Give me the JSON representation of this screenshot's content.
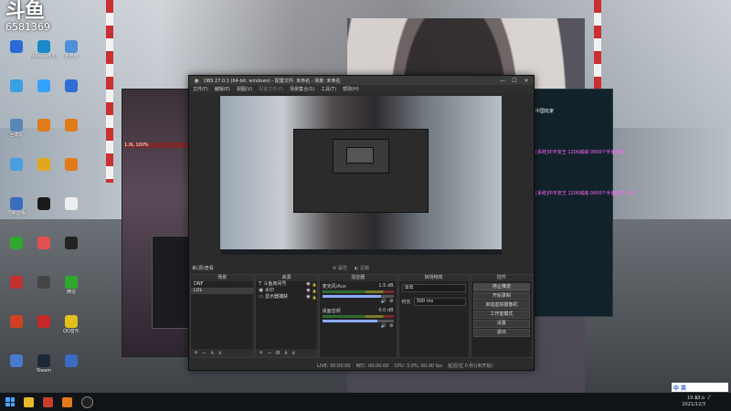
{
  "branding": {
    "logo_text": "斗鱼",
    "room_number": "6581369"
  },
  "desktop_icons": [
    {
      "label": "",
      "color": "#2a6bd6"
    },
    {
      "label": "Microsoft Edge",
      "color": "#1a88c9"
    },
    {
      "label": "此电脑",
      "color": "#4e8fd8"
    },
    {
      "label": "",
      "color": "#3aa0e0"
    },
    {
      "label": "",
      "color": "#34a1ff"
    },
    {
      "label": "",
      "color": "#2f6ed0"
    },
    {
      "label": "回收站",
      "color": "#5a86b5"
    },
    {
      "label": "",
      "color": "#e07a1a"
    },
    {
      "label": "",
      "color": "#e07a1a"
    },
    {
      "label": "",
      "color": "#4a9de0"
    },
    {
      "label": "",
      "color": "#e0a81a"
    },
    {
      "label": "",
      "color": "#e07a1a"
    },
    {
      "label": "控制面板",
      "color": "#3a6cc0"
    },
    {
      "label": "",
      "color": "#1a1a1a"
    },
    {
      "label": "",
      "color": "#eeeeee"
    },
    {
      "label": "",
      "color": "#2ea82e"
    },
    {
      "label": "",
      "color": "#e05050"
    },
    {
      "label": "",
      "color": "#222222"
    },
    {
      "label": "",
      "color": "#c2302f"
    },
    {
      "label": "",
      "color": "#444444"
    },
    {
      "label": "微信",
      "color": "#2ea82e"
    },
    {
      "label": "",
      "color": "#d04020"
    },
    {
      "label": "",
      "color": "#c62828"
    },
    {
      "label": "QQ音乐",
      "color": "#e0c01a"
    },
    {
      "label": "",
      "color": "#4a7ad0"
    },
    {
      "label": "Steam",
      "color": "#1b2838"
    },
    {
      "label": "",
      "color": "#3a6cc0"
    }
  ],
  "game_left": {
    "hp_text": "1.0L 100%"
  },
  "game_right": {
    "lines": [
      {
        "text": "中国玩家",
        "color": "#ffffff"
      },
      {
        "text": "[系统]中平安王 1200威威 0000个手面抵抗",
        "color": "#ff66ff"
      },
      {
        "text": "[系统]中平安王 1200威威 0000个手面抵抗 100",
        "color": "#ff66ff"
      }
    ]
  },
  "obs": {
    "title": "OBS 27.0.1 (64-bit, windows) - 配置文件: 未命名 - 场景: 未命名",
    "menu": [
      "文件(F)",
      "编辑(E)",
      "视图(V)",
      "配置文件(P)",
      "场景集合(S)",
      "工具(T)",
      "帮助(H)"
    ],
    "midbar": {
      "label": "来(源)查看",
      "filter1": "属性",
      "filter2": "滤镜"
    },
    "scenes": {
      "header": "场景",
      "items": [
        "DNF",
        "LOL"
      ]
    },
    "sources": {
      "header": "来源",
      "items": [
        "斗鱼房间号",
        "水印",
        "显示器捕获"
      ]
    },
    "mixer": {
      "header": "混音器",
      "channels": [
        {
          "name": "麦克风/Aux",
          "db": "1.5 dB",
          "level": 0.82
        },
        {
          "name": "桌面音频",
          "db": "0.0 dB",
          "level": 0.78
        }
      ]
    },
    "transitions": {
      "header": "转场特效",
      "type": "淡出",
      "duration_label": "时长",
      "duration_value": "300 ms"
    },
    "controls": {
      "header": "控件",
      "buttons": [
        "停止推流",
        "开始录制",
        "启动虚拟摄像机",
        "工作室模式",
        "设置",
        "退出"
      ]
    },
    "status": {
      "live": "LIVE: 00:00:00",
      "rec": "REC: 00:00:00",
      "cpu": "CPU: 3.0%, 60.00 fps",
      "lag": "延迟(位 0 秒)(未开始)"
    }
  },
  "taskbar": {
    "clock_time": "19:13",
    "clock_date": "2021/12/3",
    "ime": [
      "中",
      "英"
    ]
  }
}
